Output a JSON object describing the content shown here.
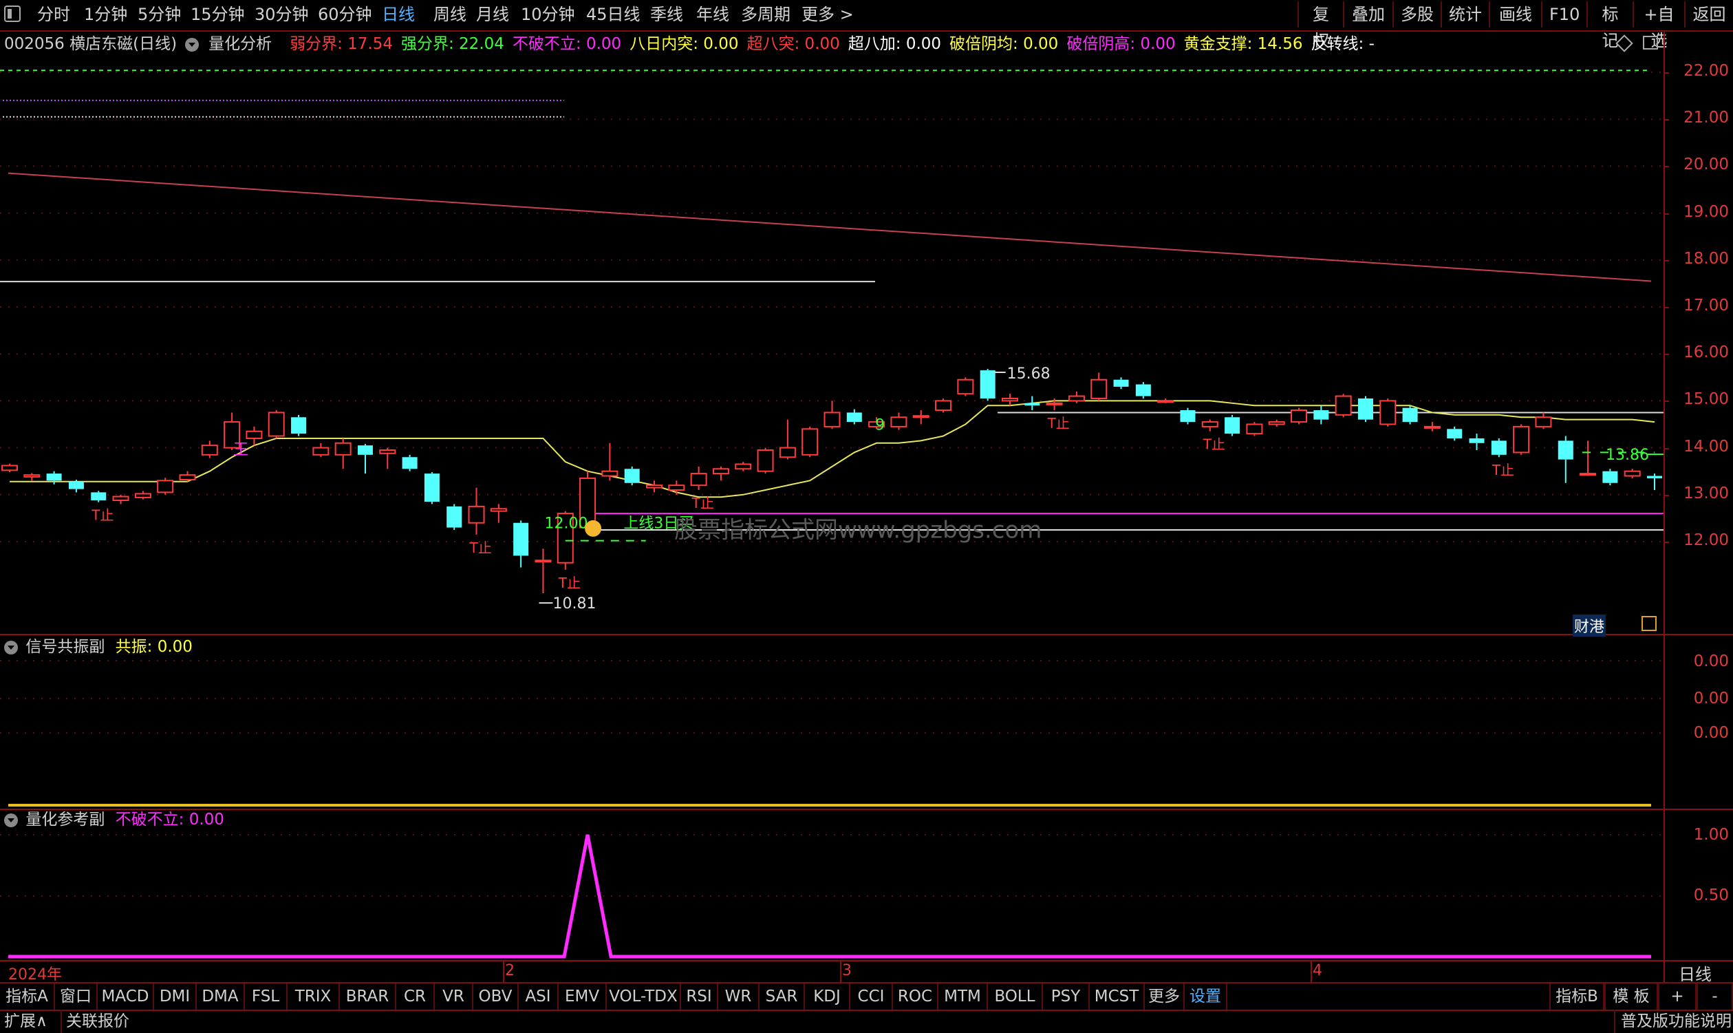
{
  "toolbar": {
    "periods": [
      "分时",
      "1分钟",
      "5分钟",
      "15分钟",
      "30分钟",
      "60分钟",
      "日线",
      "周线",
      "月线",
      "10分钟",
      "45日线",
      "季线",
      "年线",
      "多周期",
      "更多 >"
    ],
    "active_period": "日线",
    "right_buttons": [
      "复权",
      "叠加",
      "多股",
      "统计",
      "画线",
      "F10",
      "标记",
      "+自选",
      "返回"
    ]
  },
  "info": {
    "code_name": "002056 横店东磁(日线)",
    "indicator": "量化分析",
    "fields": [
      {
        "label": "弱分界: ",
        "value": "17.54",
        "color": "#ff3b3b"
      },
      {
        "label": "强分界: ",
        "value": "22.04",
        "color": "#3cff3c"
      },
      {
        "label": "不破不立: ",
        "value": "0.00",
        "color": "#ff2bff"
      },
      {
        "label": "八日内突: ",
        "value": "0.00",
        "color": "#ffff40"
      },
      {
        "label": "超八突: ",
        "value": "0.00",
        "color": "#ff3b3b"
      },
      {
        "label": "超八加: ",
        "value": "0.00",
        "color": "#ffffff"
      },
      {
        "label": "破倍阴均: ",
        "value": "0.00",
        "color": "#ffff40"
      },
      {
        "label": "破倍阴高: ",
        "value": "0.00",
        "color": "#ff2bff"
      },
      {
        "label": "黄金支撑: ",
        "value": "14.56",
        "color": "#ffff40"
      },
      {
        "label": "反转线: ",
        "value": "-",
        "color": "#ffffff"
      }
    ]
  },
  "main_chart": {
    "y_ticks": [
      "22.00",
      "21.00",
      "20.00",
      "19.00",
      "18.00",
      "17.00",
      "16.00",
      "15.00",
      "14.00",
      "13.00",
      "12.00"
    ],
    "annotations": {
      "high_label": "15.68",
      "low_label": "10.81",
      "right_label": "13.86",
      "buy_value": "12.00",
      "buy_text": "上线3日买",
      "signal_9": "9",
      "stop_text": "T止",
      "wang_text": "王",
      "watermark": "股票指标公式网www.gpzbgs.com",
      "caigang": "财港"
    },
    "candles": [
      {
        "o": 13.52,
        "c": 13.62,
        "h": 13.66,
        "l": 13.48
      },
      {
        "o": 13.38,
        "c": 13.42,
        "h": 13.46,
        "l": 13.3
      },
      {
        "o": 13.45,
        "c": 13.3,
        "h": 13.5,
        "l": 13.22
      },
      {
        "o": 13.28,
        "c": 13.12,
        "h": 13.32,
        "l": 13.05
      },
      {
        "o": 13.05,
        "c": 12.88,
        "h": 13.08,
        "l": 12.84
      },
      {
        "o": 12.88,
        "c": 12.96,
        "h": 13.0,
        "l": 12.8
      },
      {
        "o": 12.94,
        "c": 13.02,
        "h": 13.08,
        "l": 12.9
      },
      {
        "o": 13.05,
        "c": 13.3,
        "h": 13.36,
        "l": 13.0
      },
      {
        "o": 13.32,
        "c": 13.42,
        "h": 13.5,
        "l": 13.28
      },
      {
        "o": 13.85,
        "c": 14.05,
        "h": 14.15,
        "l": 13.78
      },
      {
        "o": 14.0,
        "c": 14.55,
        "h": 14.75,
        "l": 13.95
      },
      {
        "o": 14.2,
        "c": 14.35,
        "h": 14.45,
        "l": 14.05
      },
      {
        "o": 14.25,
        "c": 14.75,
        "h": 14.8,
        "l": 14.2
      },
      {
        "o": 14.65,
        "c": 14.3,
        "h": 14.7,
        "l": 14.25
      },
      {
        "o": 13.85,
        "c": 14.0,
        "h": 14.1,
        "l": 13.8
      },
      {
        "o": 13.85,
        "c": 14.1,
        "h": 14.2,
        "l": 13.55
      },
      {
        "o": 14.05,
        "c": 13.85,
        "h": 14.08,
        "l": 13.45
      },
      {
        "o": 13.88,
        "c": 13.95,
        "h": 14.0,
        "l": 13.55
      },
      {
        "o": 13.8,
        "c": 13.55,
        "h": 13.85,
        "l": 13.5
      },
      {
        "o": 13.45,
        "c": 12.85,
        "h": 13.48,
        "l": 12.8
      },
      {
        "o": 12.75,
        "c": 12.3,
        "h": 12.8,
        "l": 12.25
      },
      {
        "o": 12.4,
        "c": 12.75,
        "h": 13.15,
        "l": 12.15
      },
      {
        "o": 12.65,
        "c": 12.7,
        "h": 12.8,
        "l": 12.4
      },
      {
        "o": 12.4,
        "c": 11.7,
        "h": 12.45,
        "l": 11.45
      },
      {
        "o": 11.6,
        "c": 11.6,
        "h": 11.85,
        "l": 10.9
      },
      {
        "o": 11.55,
        "c": 12.6,
        "h": 12.65,
        "l": 11.4
      },
      {
        "o": 12.3,
        "c": 13.35,
        "h": 13.5,
        "l": 12.2
      },
      {
        "o": 13.4,
        "c": 13.5,
        "h": 14.1,
        "l": 13.3
      },
      {
        "o": 13.55,
        "c": 13.25,
        "h": 13.6,
        "l": 13.2
      },
      {
        "o": 13.15,
        "c": 13.2,
        "h": 13.3,
        "l": 13.05
      },
      {
        "o": 13.1,
        "c": 13.2,
        "h": 13.3,
        "l": 13.0
      },
      {
        "o": 13.2,
        "c": 13.45,
        "h": 13.6,
        "l": 13.1
      },
      {
        "o": 13.45,
        "c": 13.55,
        "h": 13.6,
        "l": 13.3
      },
      {
        "o": 13.55,
        "c": 13.65,
        "h": 13.7,
        "l": 13.5
      },
      {
        "o": 13.5,
        "c": 13.95,
        "h": 14.0,
        "l": 13.45
      },
      {
        "o": 13.8,
        "c": 14.0,
        "h": 14.6,
        "l": 13.75
      },
      {
        "o": 13.85,
        "c": 14.4,
        "h": 14.45,
        "l": 13.8
      },
      {
        "o": 14.45,
        "c": 14.75,
        "h": 15.0,
        "l": 14.4
      },
      {
        "o": 14.75,
        "c": 14.55,
        "h": 14.82,
        "l": 14.5
      },
      {
        "o": 14.45,
        "c": 14.55,
        "h": 14.65,
        "l": 14.4
      },
      {
        "o": 14.45,
        "c": 14.65,
        "h": 14.75,
        "l": 14.38
      },
      {
        "o": 14.65,
        "c": 14.68,
        "h": 14.8,
        "l": 14.5
      },
      {
        "o": 14.8,
        "c": 15.0,
        "h": 15.05,
        "l": 14.75
      },
      {
        "o": 15.15,
        "c": 15.45,
        "h": 15.5,
        "l": 15.1
      },
      {
        "o": 15.65,
        "c": 15.05,
        "h": 15.68,
        "l": 15.0
      },
      {
        "o": 15.0,
        "c": 15.05,
        "h": 15.15,
        "l": 14.9
      },
      {
        "o": 14.95,
        "c": 14.9,
        "h": 15.1,
        "l": 14.8
      },
      {
        "o": 14.92,
        "c": 14.95,
        "h": 15.05,
        "l": 14.8
      },
      {
        "o": 15.0,
        "c": 15.1,
        "h": 15.2,
        "l": 14.95
      },
      {
        "o": 15.05,
        "c": 15.45,
        "h": 15.6,
        "l": 15.0
      },
      {
        "o": 15.45,
        "c": 15.3,
        "h": 15.5,
        "l": 15.25
      },
      {
        "o": 15.35,
        "c": 15.1,
        "h": 15.4,
        "l": 15.05
      },
      {
        "o": 15.0,
        "c": 15.0,
        "h": 15.05,
        "l": 14.95
      },
      {
        "o": 14.8,
        "c": 14.55,
        "h": 14.85,
        "l": 14.5
      },
      {
        "o": 14.45,
        "c": 14.55,
        "h": 14.6,
        "l": 14.35
      },
      {
        "o": 14.65,
        "c": 14.3,
        "h": 14.7,
        "l": 14.25
      },
      {
        "o": 14.3,
        "c": 14.5,
        "h": 14.55,
        "l": 14.25
      },
      {
        "o": 14.5,
        "c": 14.55,
        "h": 14.6,
        "l": 14.45
      },
      {
        "o": 14.55,
        "c": 14.8,
        "h": 14.85,
        "l": 14.5
      },
      {
        "o": 14.8,
        "c": 14.6,
        "h": 14.9,
        "l": 14.5
      },
      {
        "o": 14.7,
        "c": 15.1,
        "h": 15.15,
        "l": 14.65
      },
      {
        "o": 15.05,
        "c": 14.6,
        "h": 15.1,
        "l": 14.55
      },
      {
        "o": 14.5,
        "c": 15.0,
        "h": 15.05,
        "l": 14.45
      },
      {
        "o": 14.85,
        "c": 14.55,
        "h": 14.9,
        "l": 14.5
      },
      {
        "o": 14.45,
        "c": 14.45,
        "h": 14.55,
        "l": 14.35
      },
      {
        "o": 14.4,
        "c": 14.2,
        "h": 14.45,
        "l": 14.15
      },
      {
        "o": 14.2,
        "c": 14.1,
        "h": 14.3,
        "l": 13.95
      },
      {
        "o": 14.15,
        "c": 13.85,
        "h": 14.2,
        "l": 13.8
      },
      {
        "o": 13.9,
        "c": 14.45,
        "h": 14.5,
        "l": 13.85
      },
      {
        "o": 14.45,
        "c": 14.65,
        "h": 14.75,
        "l": 14.4
      },
      {
        "o": 14.15,
        "c": 13.75,
        "h": 14.25,
        "l": 13.25
      },
      {
        "o": 13.45,
        "c": 13.45,
        "h": 14.15,
        "l": 13.4
      },
      {
        "o": 13.5,
        "c": 13.25,
        "h": 13.55,
        "l": 13.2
      },
      {
        "o": 13.4,
        "c": 13.5,
        "h": 13.55,
        "l": 13.35
      },
      {
        "o": 13.4,
        "c": 13.35,
        "h": 13.45,
        "l": 13.1
      }
    ],
    "yellow_line": [
      13.28,
      13.28,
      13.28,
      13.28,
      13.28,
      13.28,
      13.28,
      13.28,
      13.28,
      13.5,
      13.8,
      14.05,
      14.2,
      14.2,
      14.2,
      14.2,
      14.2,
      14.2,
      14.2,
      14.2,
      14.2,
      14.2,
      14.2,
      14.2,
      14.2,
      13.7,
      13.5,
      13.4,
      13.3,
      13.2,
      13.05,
      12.95,
      12.95,
      13.0,
      13.1,
      13.2,
      13.3,
      13.6,
      13.9,
      14.1,
      14.1,
      14.15,
      14.25,
      14.5,
      14.9,
      14.9,
      14.95,
      15.0,
      15.0,
      15.0,
      15.0,
      15.0,
      15.0,
      15.0,
      15.0,
      14.95,
      14.9,
      14.9,
      14.9,
      14.9,
      14.9,
      14.9,
      14.9,
      14.9,
      14.75,
      14.7,
      14.7,
      14.7,
      14.65,
      14.65,
      14.6,
      14.6,
      14.6,
      14.6,
      14.55
    ],
    "brown_line_start": 19.85,
    "brown_line_end": 17.55,
    "white_h_line": 17.54,
    "purple_top_line": 21.4,
    "white_top_line": 21.05,
    "green_dash_line": 22.04,
    "magenta_line": 12.6,
    "white_low_line": 12.25,
    "trend_white_line": 14.75
  },
  "sub1": {
    "title": "信号共振副",
    "field_label": "共振: ",
    "field_value": "0.00",
    "y_ticks": [
      "0.00",
      "0.00",
      "0.00"
    ]
  },
  "sub2": {
    "title": "量化参考副",
    "field_label": "不破不立: ",
    "field_value": "0.00",
    "y_ticks": [
      "1.00",
      "0.50"
    ],
    "spike_index": 26
  },
  "dates": {
    "year": "2024年",
    "m2": "2",
    "m3": "3",
    "m4": "4",
    "period": "日线"
  },
  "indicator_bar": [
    "指标A",
    "窗口",
    "MACD",
    "DMI",
    "DMA",
    "FSL",
    "TRIX",
    "BRAR",
    "CR",
    "VR",
    "OBV",
    "ASI",
    "EMV",
    "VOL-TDX",
    "RSI",
    "WR",
    "SAR",
    "KDJ",
    "CCI",
    "ROC",
    "MTM",
    "BOLL",
    "PSY",
    "MCST",
    "更多",
    "设置"
  ],
  "indicator_bar_right": [
    "指标B",
    "模 板",
    "+",
    "-"
  ],
  "ext_bar": {
    "left1": "扩展∧",
    "left2": "关联报价",
    "right": "普及版功能说明"
  },
  "colors": {
    "up": "#ff3b3b",
    "down": "#54ffff",
    "ma": "#e8e85a",
    "magenta": "#ff2bff"
  }
}
